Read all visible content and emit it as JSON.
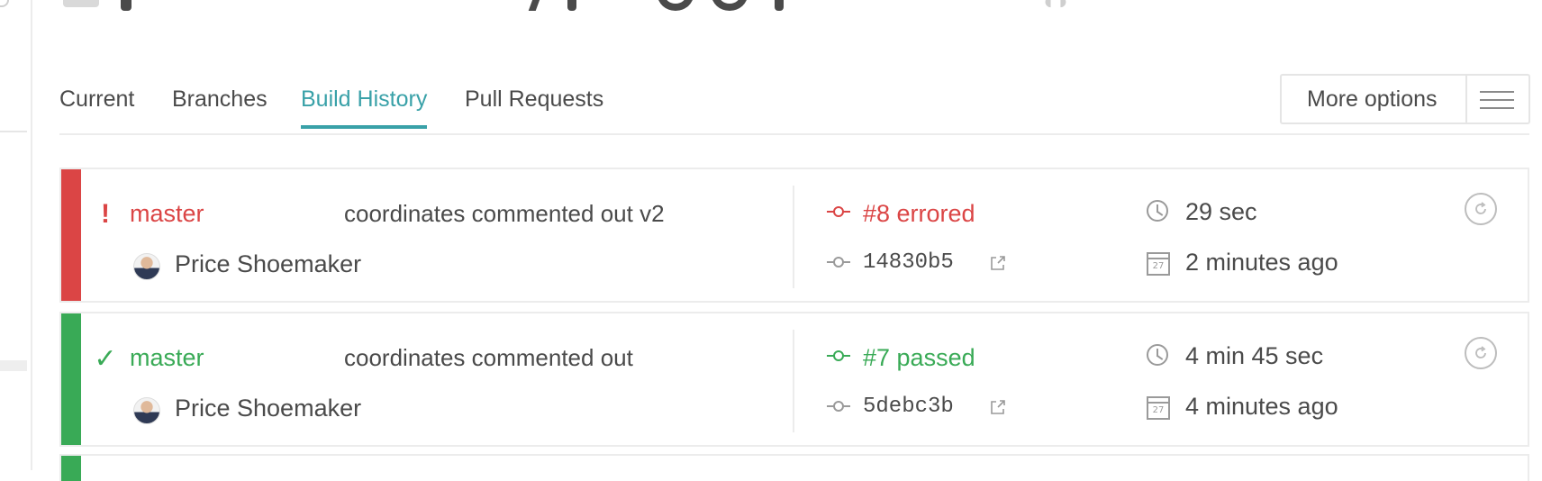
{
  "tabs": [
    {
      "label": "Current",
      "active": false
    },
    {
      "label": "Branches",
      "active": false
    },
    {
      "label": "Build History",
      "active": true
    },
    {
      "label": "Pull Requests",
      "active": false
    }
  ],
  "more_options": {
    "label": "More options",
    "icon": "hamburger-menu-icon"
  },
  "colors": {
    "errored": "#db4545",
    "passed": "#39aa56",
    "accent": "#39a1a8",
    "text": "#4a4a4a"
  },
  "builds": [
    {
      "state": "errored",
      "state_icon": "!",
      "branch": "master",
      "message": "coordinates commented out v2",
      "author": "Price Shoemaker",
      "build_label": "#8 errored",
      "commit_sha": "14830b5",
      "duration": "29 sec",
      "finished": "2 minutes ago",
      "calendar_day": "27"
    },
    {
      "state": "passed",
      "state_icon": "✓",
      "branch": "master",
      "message": "coordinates commented out",
      "author": "Price Shoemaker",
      "build_label": "#7 passed",
      "commit_sha": "5debc3b",
      "duration": "4 min 45 sec",
      "finished": "4 minutes ago",
      "calendar_day": "27"
    }
  ]
}
